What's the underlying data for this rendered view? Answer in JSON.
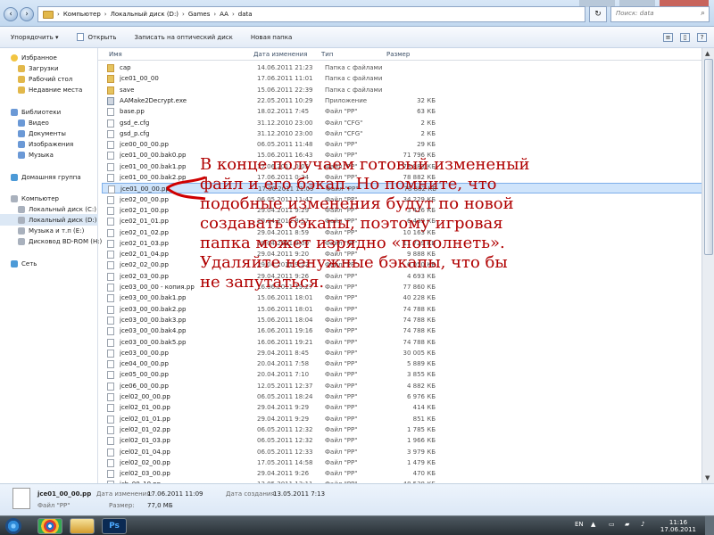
{
  "address": {
    "breadcrumbs": [
      "Компьютер",
      "Локальный диск (D:)",
      "Games",
      "AA",
      "data"
    ],
    "search_placeholder": "Поиск: data"
  },
  "toolbar": {
    "items": [
      "Упорядочить ▾",
      "Открыть",
      "Записать на оптический диск",
      "Новая папка"
    ]
  },
  "sidebar": {
    "items": [
      "Избранное",
      "Загрузки",
      "Рабочий стол",
      "Недавние места",
      "Библиотеки",
      "Видео",
      "Документы",
      "Изображения",
      "Музыка",
      "Домашняя группа",
      "Компьютер",
      "Локальный диск (C:)",
      "Локальный диск (D:)",
      "Музыка и т.п (E:)",
      "Дисковод BD-ROM (H:)",
      "Сеть"
    ]
  },
  "files": {
    "columns": [
      "Имя",
      "Дата изменения",
      "Тип",
      "Размер"
    ],
    "rows": [
      {
        "name": "cap",
        "date": "14.06.2011 21:23",
        "type": "Папка с файлами",
        "size": ""
      },
      {
        "name": "jce01_00_00",
        "date": "17.06.2011 11:01",
        "type": "Папка с файлами",
        "size": ""
      },
      {
        "name": "save",
        "date": "15.06.2011 22:39",
        "type": "Папка с файлами",
        "size": ""
      },
      {
        "name": "AAMake2Decrypt.exe",
        "date": "22.05.2011 10:29",
        "type": "Приложение",
        "size": "32 КБ"
      },
      {
        "name": "base.pp",
        "date": "18.02.2011 7:45",
        "type": "Файл \"PP\"",
        "size": "63 КБ"
      },
      {
        "name": "gsd_e.cfg",
        "date": "31.12.2010 23:00",
        "type": "Файл \"CFG\"",
        "size": "2 КБ"
      },
      {
        "name": "gsd_p.cfg",
        "date": "31.12.2010 23:00",
        "type": "Файл \"CFG\"",
        "size": "2 КБ"
      },
      {
        "name": "jce00_00_00.pp",
        "date": "06.05.2011 11:48",
        "type": "Файл \"PP\"",
        "size": "29 КБ"
      },
      {
        "name": "jce01_00_00.bak0.pp",
        "date": "15.06.2011 16:43",
        "type": "Файл \"PP\"",
        "size": "71 796 КБ"
      },
      {
        "name": "jce01_00_00.bak1.pp",
        "date": "17.06.2011 0:05",
        "type": "Файл \"PP\"",
        "size": "78 883 КБ"
      },
      {
        "name": "jce01_00_00.bak2.pp",
        "date": "17.06.2011 0:34",
        "type": "Файл \"PP\"",
        "size": "78 882 КБ"
      },
      {
        "name": "jce01_00_00.pp",
        "date": "17.06.2011 11:09",
        "type": "Файл \"PP\"",
        "size": "78 882 КБ"
      },
      {
        "name": "jce02_00_00.pp",
        "date": "06.05.2011 11:47",
        "type": "Файл \"PP\"",
        "size": "34 229 КБ"
      },
      {
        "name": "jce02_01_00.pp",
        "date": "29.04.2011 9:29",
        "type": "Файл \"PP\"",
        "size": "3 426 КБ"
      },
      {
        "name": "jce02_01_01.pp",
        "date": "29.04.2011 8:57",
        "type": "Файл \"PP\"",
        "size": "6 439 КБ"
      },
      {
        "name": "jce02_01_02.pp",
        "date": "29.04.2011 8:59",
        "type": "Файл \"PP\"",
        "size": "10 163 КБ"
      },
      {
        "name": "jce02_01_03.pp",
        "date": "29.04.2011 9:00",
        "type": "Файл \"PP\"",
        "size": "11 729 КБ"
      },
      {
        "name": "jce02_01_04.pp",
        "date": "29.04.2011 9:20",
        "type": "Файл \"PP\"",
        "size": "9 888 КБ"
      },
      {
        "name": "jce02_02_00.pp",
        "date": "29.04.2011 9:22",
        "type": "Файл \"PP\"",
        "size": "6 050 КБ"
      },
      {
        "name": "jce02_03_00.pp",
        "date": "29.04.2011 9:26",
        "type": "Файл \"PP\"",
        "size": "4 693 КБ"
      },
      {
        "name": "jce03_00_00 - копия.pp",
        "date": "16.06.2011 19:27",
        "type": "Файл \"PP\"",
        "size": "77 860 КБ"
      },
      {
        "name": "jce03_00_00.bak1.pp",
        "date": "15.06.2011 18:01",
        "type": "Файл \"PP\"",
        "size": "40 228 КБ"
      },
      {
        "name": "jce03_00_00.bak2.pp",
        "date": "15.06.2011 18:01",
        "type": "Файл \"PP\"",
        "size": "74 788 КБ"
      },
      {
        "name": "jce03_00_00.bak3.pp",
        "date": "15.06.2011 18:04",
        "type": "Файл \"PP\"",
        "size": "74 788 КБ"
      },
      {
        "name": "jce03_00_00.bak4.pp",
        "date": "16.06.2011 19:16",
        "type": "Файл \"PP\"",
        "size": "74 788 КБ"
      },
      {
        "name": "jce03_00_00.bak5.pp",
        "date": "16.06.2011 19:21",
        "type": "Файл \"PP\"",
        "size": "74 788 КБ"
      },
      {
        "name": "jce03_00_00.pp",
        "date": "29.04.2011 8:45",
        "type": "Файл \"PP\"",
        "size": "30 005 КБ"
      },
      {
        "name": "jce04_00_00.pp",
        "date": "20.04.2011 7:58",
        "type": "Файл \"PP\"",
        "size": "5 889 КБ"
      },
      {
        "name": "jce05_00_00.pp",
        "date": "20.04.2011 7:10",
        "type": "Файл \"PP\"",
        "size": "3 855 КБ"
      },
      {
        "name": "jce06_00_00.pp",
        "date": "12.05.2011 12:37",
        "type": "Файл \"PP\"",
        "size": "4 882 КБ"
      },
      {
        "name": "jcel02_00_00.pp",
        "date": "06.05.2011 18:24",
        "type": "Файл \"PP\"",
        "size": "6 976 КБ"
      },
      {
        "name": "jcel02_01_00.pp",
        "date": "29.04.2011 9:29",
        "type": "Файл \"PP\"",
        "size": "414 КБ"
      },
      {
        "name": "jcel02_01_01.pp",
        "date": "29.04.2011 9:29",
        "type": "Файл \"PP\"",
        "size": "851 КБ"
      },
      {
        "name": "jcel02_01_02.pp",
        "date": "06.05.2011 12:32",
        "type": "Файл \"PP\"",
        "size": "1 785 КБ"
      },
      {
        "name": "jcel02_01_03.pp",
        "date": "06.05.2011 12:32",
        "type": "Файл \"PP\"",
        "size": "1 966 КБ"
      },
      {
        "name": "jcel02_01_04.pp",
        "date": "06.05.2011 12:33",
        "type": "Файл \"PP\"",
        "size": "3 979 КБ"
      },
      {
        "name": "jcel02_02_00.pp",
        "date": "17.05.2011 14:58",
        "type": "Файл \"PP\"",
        "size": "1 479 КБ"
      },
      {
        "name": "jcel02_03_00.pp",
        "date": "29.04.2011 9:26",
        "type": "Файл \"PP\"",
        "size": "470 КБ"
      },
      {
        "name": "jcb_00_10.pp",
        "date": "13.05.2011 13:11",
        "type": "Файл \"PP\"",
        "size": "48 538 КБ"
      }
    ]
  },
  "annotation": {
    "text": "В конце получаем готовый измененый файл и его бэкап. Но помните, что подобные изменения будут по новой создавать бэкапы, поэтому игровая папка может изрядно «пополнеть». Удаляйте ненужные бэкапы, что бы не запутаться."
  },
  "details": {
    "file_name": "jce01_00_00.pp",
    "modified_label": "Дата изменения:",
    "modified": "17.06.2011 11:09",
    "created_label": "Дата создания:",
    "created": "13.05.2011 7:13",
    "type": "Файл \"PP\"",
    "size_label": "Размер:",
    "size": "77,0 МБ"
  },
  "taskbar": {
    "language": "EN",
    "time": "11:16",
    "date": "17.06.2011",
    "photoshop": "Ps"
  }
}
